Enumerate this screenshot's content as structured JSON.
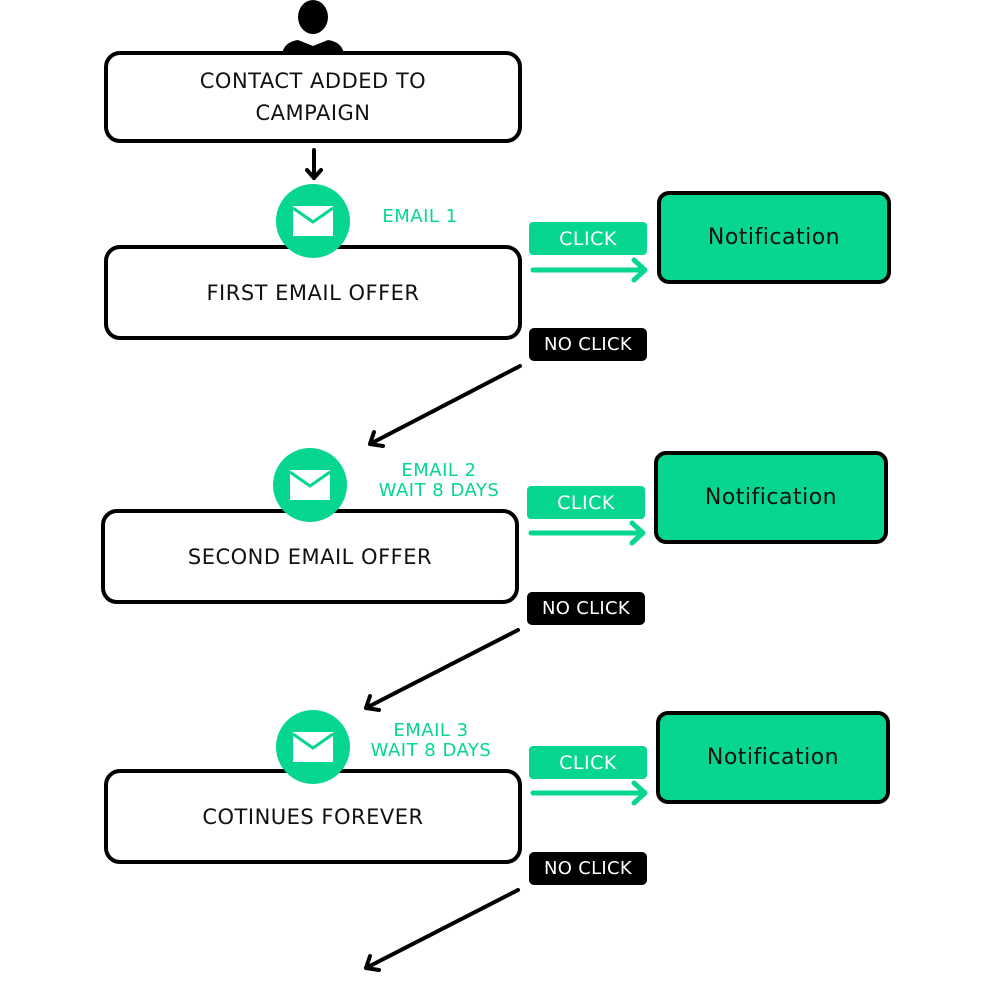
{
  "diagram": {
    "start": {
      "icon": "person-icon",
      "label_line1": "CONTACT ADDED TO",
      "label_line2": "CAMPAIGN"
    },
    "steps": [
      {
        "email_label_line1": "EMAIL 1",
        "email_label_line2": "",
        "box_label": "FIRST EMAIL OFFER",
        "click_label": "CLICK",
        "no_click_label": "NO CLICK",
        "notification_label": "Notification",
        "icon": "envelope-icon"
      },
      {
        "email_label_line1": "EMAIL 2",
        "email_label_line2": "WAIT 8 DAYS",
        "box_label": "SECOND EMAIL OFFER",
        "click_label": "CLICK",
        "no_click_label": "NO CLICK",
        "notification_label": "Notification",
        "icon": "envelope-icon"
      },
      {
        "email_label_line1": "EMAIL 3",
        "email_label_line2": "WAIT 8 DAYS",
        "box_label": "COTINUES FOREVER",
        "click_label": "CLICK",
        "no_click_label": "NO CLICK",
        "notification_label": "Notification",
        "icon": "envelope-icon"
      }
    ],
    "colors": {
      "accent": "#06d68f",
      "stroke": "#000000",
      "background": "#ffffff"
    }
  }
}
